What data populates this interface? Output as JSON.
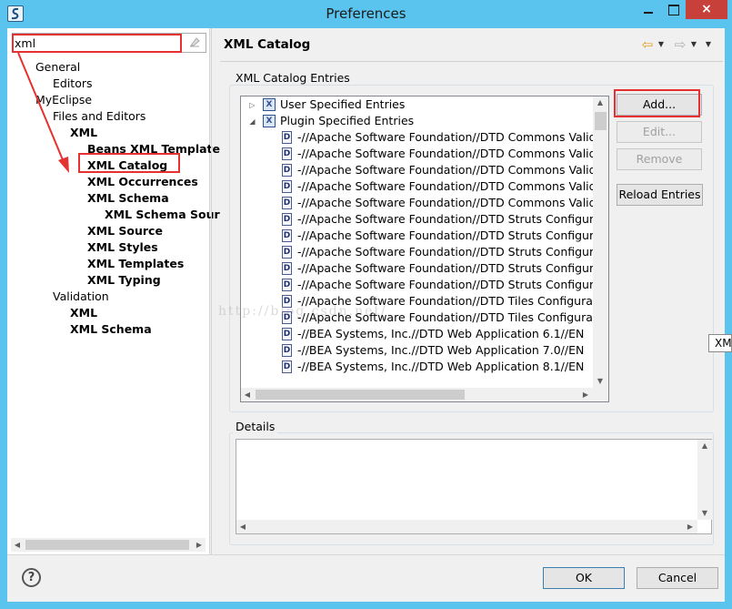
{
  "window": {
    "title": "Preferences",
    "close_glyph": "×"
  },
  "left": {
    "filter_value": "xml",
    "tree": [
      {
        "label": "General",
        "bold": false
      },
      {
        "label": "Editors",
        "bold": false
      },
      {
        "label": "MyEclipse",
        "bold": false
      },
      {
        "label": "Files and Editors",
        "bold": false
      },
      {
        "label": "XML",
        "bold": true
      },
      {
        "label": "Beans XML Template",
        "bold": true
      },
      {
        "label": "XML Catalog",
        "bold": true
      },
      {
        "label": "XML Occurrences",
        "bold": true
      },
      {
        "label": "XML Schema",
        "bold": true
      },
      {
        "label": "XML Schema Sour",
        "bold": true
      },
      {
        "label": "XML Source",
        "bold": true
      },
      {
        "label": "XML Styles",
        "bold": true
      },
      {
        "label": "XML Templates",
        "bold": true
      },
      {
        "label": "XML Typing",
        "bold": true
      },
      {
        "label": "Validation",
        "bold": false
      },
      {
        "label": "XML",
        "bold": true
      },
      {
        "label": "XML Schema",
        "bold": true
      }
    ]
  },
  "page": {
    "title": "XML Catalog",
    "entries_group_label": "XML Catalog Entries",
    "details_group_label": "Details",
    "entries": [
      {
        "label": "User Specified Entries",
        "kind": "category"
      },
      {
        "label": "Plugin Specified Entries",
        "kind": "category"
      },
      {
        "label": "-//Apache Software Foundation//DTD Commons Validat",
        "kind": "dtd"
      },
      {
        "label": "-//Apache Software Foundation//DTD Commons Validat",
        "kind": "dtd"
      },
      {
        "label": "-//Apache Software Foundation//DTD Commons Validat",
        "kind": "dtd"
      },
      {
        "label": "-//Apache Software Foundation//DTD Commons Validat",
        "kind": "dtd"
      },
      {
        "label": "-//Apache Software Foundation//DTD Commons Validat",
        "kind": "dtd"
      },
      {
        "label": "-//Apache Software Foundation//DTD Struts Configurati",
        "kind": "dtd"
      },
      {
        "label": "-//Apache Software Foundation//DTD Struts Configurati",
        "kind": "dtd"
      },
      {
        "label": "-//Apache Software Foundation//DTD Struts Configurati",
        "kind": "dtd"
      },
      {
        "label": "-//Apache Software Foundation//DTD Struts Configurati",
        "kind": "dtd"
      },
      {
        "label": "-//Apache Software Foundation//DTD Struts Configurati",
        "kind": "dtd"
      },
      {
        "label": "-//Apache Software Foundation//DTD Tiles Configuratio",
        "kind": "dtd"
      },
      {
        "label": "-//Apache Software Foundation//DTD Tiles Configuratio",
        "kind": "dtd"
      },
      {
        "label": "-//BEA Systems, Inc.//DTD Web Application 6.1//EN",
        "kind": "dtd"
      },
      {
        "label": "-//BEA Systems, Inc.//DTD Web Application 7.0//EN",
        "kind": "dtd"
      },
      {
        "label": "-//BEA Systems, Inc.//DTD Web Application 8.1//EN",
        "kind": "dtd"
      }
    ],
    "buttons": {
      "add": "Add...",
      "edit": "Edit...",
      "remove": "Remove",
      "reload": "Reload Entries"
    }
  },
  "footer": {
    "ok": "OK",
    "cancel": "Cancel",
    "help_glyph": "?"
  },
  "overlay": {
    "tooltip_text": "XM",
    "watermark": "http://blog.csdn.net/"
  },
  "colors": {
    "annotation": "#e5312f",
    "frame": "#5ac4ee"
  }
}
